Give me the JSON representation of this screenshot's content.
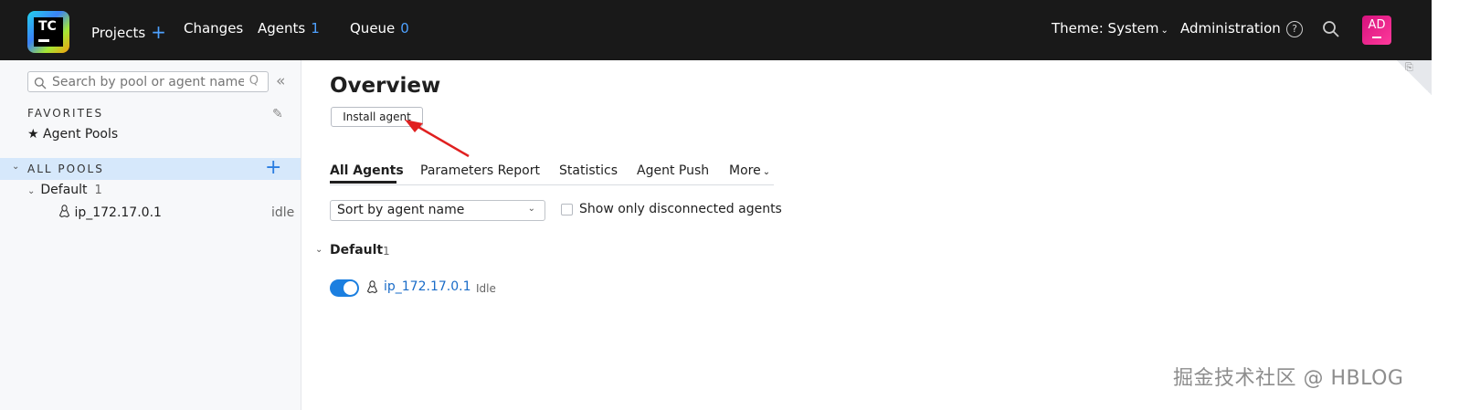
{
  "header": {
    "logo_text": "TC",
    "nav": {
      "projects": "Projects",
      "changes": "Changes",
      "agents": "Agents",
      "agents_count": "1",
      "queue": "Queue",
      "queue_count": "0"
    },
    "theme": "Theme: System",
    "administration": "Administration",
    "avatar": "AD"
  },
  "sidebar": {
    "search_placeholder": "Search by pool or agent name",
    "favorites_title": "FAVORITES",
    "favorites_item": "Agent Pools",
    "all_pools": "ALL POOLS",
    "pool": {
      "name": "Default",
      "count": "1"
    },
    "agent": {
      "name": "ip_172.17.0.1",
      "status": "idle"
    }
  },
  "main": {
    "title": "Overview",
    "install_button": "Install agent",
    "tabs": [
      "All Agents",
      "Parameters Report",
      "Statistics",
      "Agent Push",
      "More"
    ],
    "sort_value": "Sort by agent name",
    "checkbox_label": "Show only disconnected agents",
    "group": {
      "name": "Default",
      "count": "1"
    },
    "agent": {
      "name": "ip_172.17.0.1",
      "status": "Idle",
      "enabled": true
    }
  },
  "watermark": "掘金技术社区 @ HBLOG",
  "colors": {
    "topbar": "#191919",
    "accent": "#4ea1ff",
    "link": "#1a6cc8",
    "toggle": "#1b7fe0",
    "selection": "#d6e8fb",
    "annotation_arrow": "#e02020"
  }
}
